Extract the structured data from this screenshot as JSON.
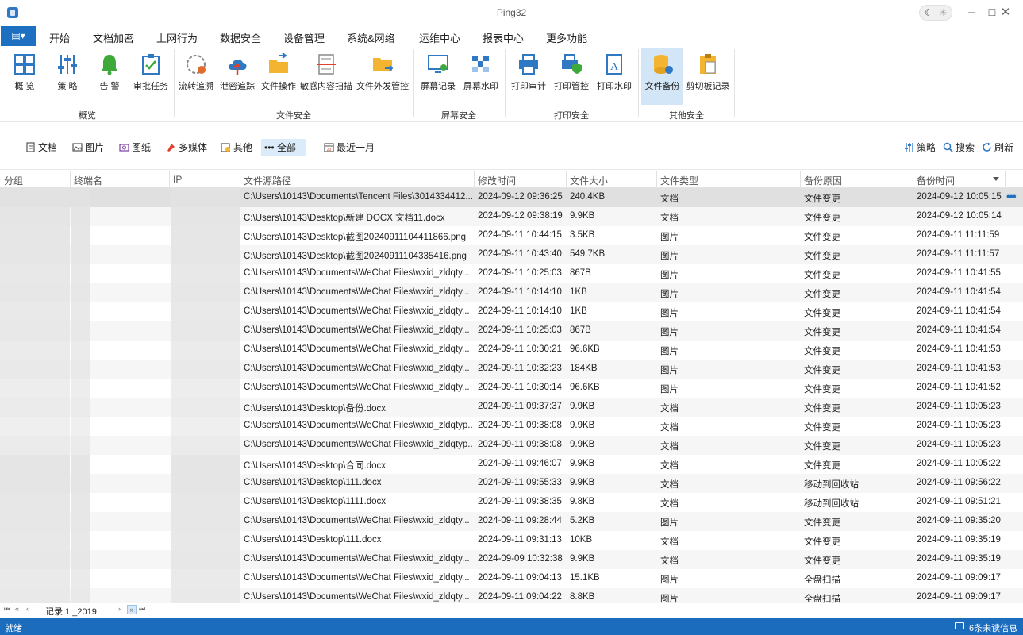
{
  "window": {
    "title": "Ping32"
  },
  "menu": {
    "tabs": [
      "开始",
      "文档加密",
      "上网行为",
      "数据安全",
      "设备管理",
      "系统&网络",
      "运维中心",
      "报表中心",
      "更多功能"
    ],
    "active": "数据安全"
  },
  "ribbon": {
    "groups": {
      "overview": "概览",
      "file_security": "文件安全",
      "screen_security": "屏幕安全",
      "print_security": "打印安全",
      "other_security": "其他安全"
    },
    "buttons": {
      "overview": "概 览",
      "policy": "策 略",
      "alert": "告 警",
      "approval": "审批任务",
      "flow_trace": "流转追溯",
      "leak_trace": "泄密追踪",
      "file_ops": "文件操作",
      "sensitive_scan": "敏感内容扫描",
      "file_outgoing": "文件外发管控",
      "screen_record": "屏幕记录",
      "screen_watermark": "屏幕水印",
      "print_audit": "打印审计",
      "print_control": "打印管控",
      "print_watermark": "打印水印",
      "file_backup": "文件备份",
      "clipboard": "剪切板记录"
    },
    "selected": "文件备份"
  },
  "filters": {
    "doc": "文档",
    "image": "图片",
    "drawing": "图纸",
    "media": "多媒体",
    "other": "其他",
    "all": "••• 全部",
    "range": "最近一月",
    "policy": "策略",
    "search": "搜索",
    "refresh": "刷新",
    "selected": "全部"
  },
  "table": {
    "columns": {
      "group": "分组",
      "terminal": "终端名",
      "ip": "IP",
      "path": "文件源路径",
      "mtime": "修改时间",
      "size": "文件大小",
      "type": "文件类型",
      "reason": "备份原因",
      "btime": "备份时间"
    },
    "rows": [
      {
        "path": "C:\\Users\\10143\\Documents\\Tencent Files\\3014334412...",
        "mtime": "2024-09-12 09:36:25",
        "size": "240.4KB",
        "type": "文档",
        "reason": "文件变更",
        "btime": "2024-09-12 10:05:15"
      },
      {
        "path": "C:\\Users\\10143\\Desktop\\新建 DOCX 文档11.docx",
        "mtime": "2024-09-12 09:38:19",
        "size": "9.9KB",
        "type": "文档",
        "reason": "文件变更",
        "btime": "2024-09-12 10:05:14"
      },
      {
        "path": "C:\\Users\\10143\\Desktop\\截图20240911104411866.png",
        "mtime": "2024-09-11 10:44:15",
        "size": "3.5KB",
        "type": "图片",
        "reason": "文件变更",
        "btime": "2024-09-11 11:11:59"
      },
      {
        "path": "C:\\Users\\10143\\Desktop\\截图20240911104335416.png",
        "mtime": "2024-09-11 10:43:40",
        "size": "549.7KB",
        "type": "图片",
        "reason": "文件变更",
        "btime": "2024-09-11 11:11:57"
      },
      {
        "path": "C:\\Users\\10143\\Documents\\WeChat Files\\wxid_zldqty...",
        "mtime": "2024-09-11 10:25:03",
        "size": "867B",
        "type": "图片",
        "reason": "文件变更",
        "btime": "2024-09-11 10:41:55"
      },
      {
        "path": "C:\\Users\\10143\\Documents\\WeChat Files\\wxid_zldqty...",
        "mtime": "2024-09-11 10:14:10",
        "size": "1KB",
        "type": "图片",
        "reason": "文件变更",
        "btime": "2024-09-11 10:41:54"
      },
      {
        "path": "C:\\Users\\10143\\Documents\\WeChat Files\\wxid_zldqty...",
        "mtime": "2024-09-11 10:14:10",
        "size": "1KB",
        "type": "图片",
        "reason": "文件变更",
        "btime": "2024-09-11 10:41:54"
      },
      {
        "path": "C:\\Users\\10143\\Documents\\WeChat Files\\wxid_zldqty...",
        "mtime": "2024-09-11 10:25:03",
        "size": "867B",
        "type": "图片",
        "reason": "文件变更",
        "btime": "2024-09-11 10:41:54"
      },
      {
        "path": "C:\\Users\\10143\\Documents\\WeChat Files\\wxid_zldqty...",
        "mtime": "2024-09-11 10:30:21",
        "size": "96.6KB",
        "type": "图片",
        "reason": "文件变更",
        "btime": "2024-09-11 10:41:53"
      },
      {
        "path": "C:\\Users\\10143\\Documents\\WeChat Files\\wxid_zldqty...",
        "mtime": "2024-09-11 10:32:23",
        "size": "184KB",
        "type": "图片",
        "reason": "文件变更",
        "btime": "2024-09-11 10:41:53"
      },
      {
        "path": "C:\\Users\\10143\\Documents\\WeChat Files\\wxid_zldqty...",
        "mtime": "2024-09-11 10:30:14",
        "size": "96.6KB",
        "type": "图片",
        "reason": "文件变更",
        "btime": "2024-09-11 10:41:52"
      },
      {
        "path": "C:\\Users\\10143\\Desktop\\备份.docx",
        "mtime": "2024-09-11 09:37:37",
        "size": "9.9KB",
        "type": "文档",
        "reason": "文件变更",
        "btime": "2024-09-11 10:05:23"
      },
      {
        "path": "C:\\Users\\10143\\Documents\\WeChat Files\\wxid_zldqtyp...",
        "mtime": "2024-09-11 09:38:08",
        "size": "9.9KB",
        "type": "文档",
        "reason": "文件变更",
        "btime": "2024-09-11 10:05:23"
      },
      {
        "path": "C:\\Users\\10143\\Documents\\WeChat Files\\wxid_zldqtyp...",
        "mtime": "2024-09-11 09:38:08",
        "size": "9.9KB",
        "type": "文档",
        "reason": "文件变更",
        "btime": "2024-09-11 10:05:23"
      },
      {
        "path": "C:\\Users\\10143\\Desktop\\合同.docx",
        "mtime": "2024-09-11 09:46:07",
        "size": "9.9KB",
        "type": "文档",
        "reason": "文件变更",
        "btime": "2024-09-11 10:05:22"
      },
      {
        "path": "C:\\Users\\10143\\Desktop\\111.docx",
        "mtime": "2024-09-11 09:55:33",
        "size": "9.9KB",
        "type": "文档",
        "reason": "移动到回收站",
        "btime": "2024-09-11 09:56:22"
      },
      {
        "path": "C:\\Users\\10143\\Desktop\\1111.docx",
        "mtime": "2024-09-11 09:38:35",
        "size": "9.8KB",
        "type": "文档",
        "reason": "移动到回收站",
        "btime": "2024-09-11 09:51:21"
      },
      {
        "path": "C:\\Users\\10143\\Documents\\WeChat Files\\wxid_zldqty...",
        "mtime": "2024-09-11 09:28:44",
        "size": "5.2KB",
        "type": "图片",
        "reason": "文件变更",
        "btime": "2024-09-11 09:35:20"
      },
      {
        "path": "C:\\Users\\10143\\Desktop\\111.docx",
        "mtime": "2024-09-11 09:31:13",
        "size": "10KB",
        "type": "文档",
        "reason": "文件变更",
        "btime": "2024-09-11 09:35:19"
      },
      {
        "path": "C:\\Users\\10143\\Documents\\WeChat Files\\wxid_zldqty...",
        "mtime": "2024-09-09 10:32:38",
        "size": "9.9KB",
        "type": "文档",
        "reason": "文件变更",
        "btime": "2024-09-11 09:35:19"
      },
      {
        "path": "C:\\Users\\10143\\Documents\\WeChat Files\\wxid_zldqty...",
        "mtime": "2024-09-11 09:04:13",
        "size": "15.1KB",
        "type": "图片",
        "reason": "全盘扫描",
        "btime": "2024-09-11 09:09:17"
      },
      {
        "path": "C:\\Users\\10143\\Documents\\WeChat Files\\wxid_zldqty...",
        "mtime": "2024-09-11 09:04:22",
        "size": "8.8KB",
        "type": "图片",
        "reason": "全盘扫描",
        "btime": "2024-09-11 09:09:17"
      }
    ]
  },
  "pager": {
    "text": "记录 1  _2019"
  },
  "status": {
    "left": "就绪",
    "messages": "6条未读信息"
  },
  "colors": {
    "accent": "#1c6cbe",
    "selected_ribbon": "#d2e6f8"
  }
}
